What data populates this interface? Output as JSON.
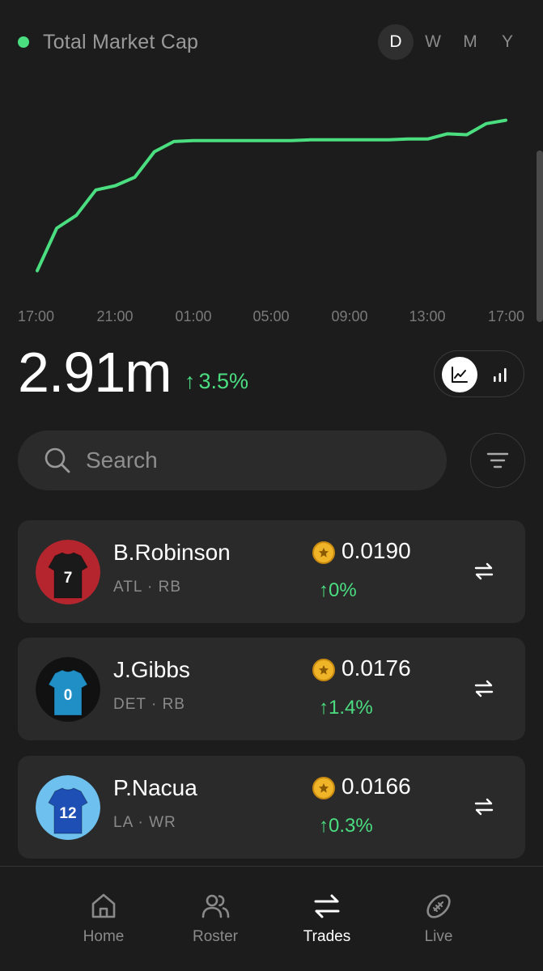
{
  "header": {
    "title": "Total Market Cap",
    "live_color": "#4ade80",
    "ranges": [
      "D",
      "W",
      "M",
      "Y"
    ],
    "active_range": "D"
  },
  "chart_data": {
    "type": "line",
    "title": "",
    "xlabel": "",
    "ylabel": "",
    "color": "#4ade80",
    "x_ticks": [
      "17:00",
      "21:00",
      "01:00",
      "05:00",
      "09:00",
      "13:00",
      "17:00"
    ],
    "x": [
      0,
      1,
      2,
      3,
      4,
      5,
      6,
      7,
      8,
      9,
      10,
      11,
      12,
      13,
      14,
      15,
      16,
      17,
      18,
      19,
      20,
      21,
      22,
      23,
      24
    ],
    "values": [
      2.81,
      2.86,
      2.875,
      2.905,
      2.91,
      2.92,
      2.95,
      2.962,
      2.963,
      2.963,
      2.963,
      2.963,
      2.963,
      2.963,
      2.964,
      2.964,
      2.964,
      2.964,
      2.964,
      2.965,
      2.965,
      2.971,
      2.97,
      2.983,
      2.987
    ],
    "grid": false,
    "legend": "none"
  },
  "summary": {
    "value": "2.91m",
    "change": "3.5%",
    "change_arrow": "↑",
    "up_color": "#4ade80"
  },
  "view_toggle": {
    "active": "line-chart",
    "options": [
      "line-chart",
      "bar-chart"
    ]
  },
  "search": {
    "placeholder": "Search",
    "value": ""
  },
  "players": [
    {
      "name": "B.Robinson",
      "team": "ATL",
      "position": "RB",
      "price": "0.0190",
      "change": "0%",
      "jersey_number": "7",
      "jersey_color": "#1a1a1a",
      "bg_color": "#b5252e"
    },
    {
      "name": "J.Gibbs",
      "team": "DET",
      "position": "RB",
      "price": "0.0176",
      "change": "1.4%",
      "jersey_number": "0",
      "jersey_color": "#1f8fc6",
      "bg_color": "#111111"
    },
    {
      "name": "P.Nacua",
      "team": "LA",
      "position": "WR",
      "price": "0.0166",
      "change": "0.3%",
      "jersey_number": "12",
      "jersey_color": "#1e4fb5",
      "bg_color": "#6ec1ef"
    }
  ],
  "separator": "·",
  "nav": {
    "items": [
      {
        "label": "Home",
        "icon": "home-icon"
      },
      {
        "label": "Roster",
        "icon": "users-icon"
      },
      {
        "label": "Trades",
        "icon": "swap-icon"
      },
      {
        "label": "Live",
        "icon": "football-icon"
      }
    ],
    "active": "Trades"
  }
}
